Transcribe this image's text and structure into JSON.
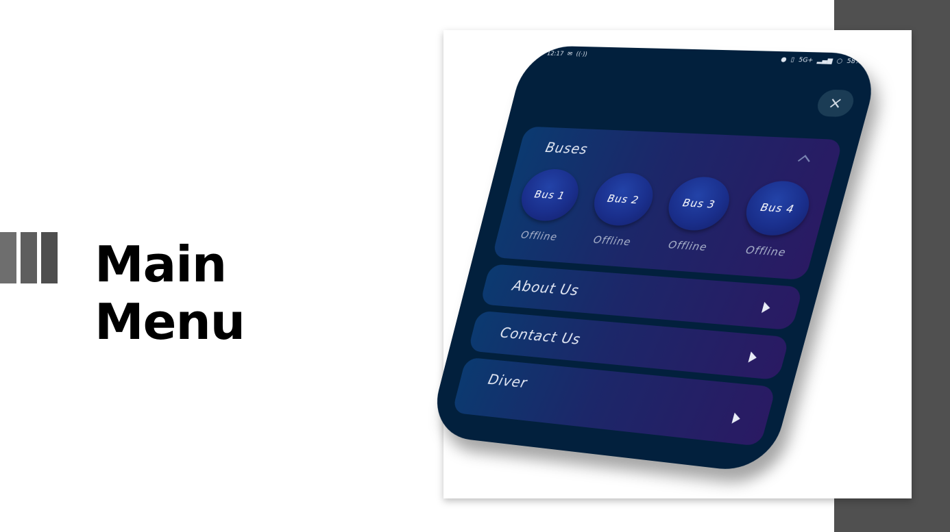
{
  "slide": {
    "title_line1": "Main",
    "title_line2": "Menu"
  },
  "phone": {
    "status": {
      "time": "12:17",
      "battery": "58%",
      "network": "5G+"
    },
    "close_label": "×",
    "buses_section": {
      "title": "Buses",
      "expanded": true,
      "buses": [
        {
          "label": "Bus 1",
          "status": "Offline"
        },
        {
          "label": "Bus 2",
          "status": "Offline"
        },
        {
          "label": "Bus 3",
          "status": "Offline"
        },
        {
          "label": "Bus 4",
          "status": "Offline"
        }
      ]
    },
    "menu_items": [
      {
        "label": "About Us"
      },
      {
        "label": "Contact Us"
      },
      {
        "label": "Diver"
      }
    ]
  },
  "colors": {
    "phone_bg": "#02203d",
    "card_gradient_start": "#0b3a70",
    "card_gradient_end": "#2a1a63",
    "side_panel": "#505050"
  }
}
